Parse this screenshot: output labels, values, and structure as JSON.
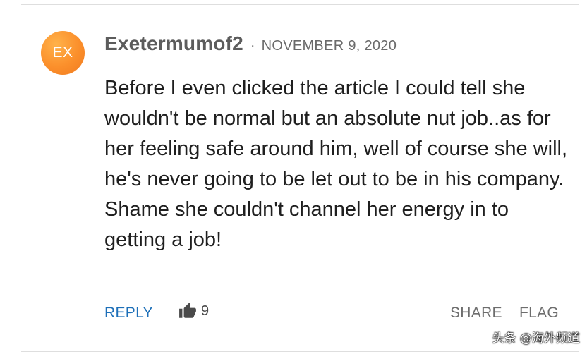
{
  "comment": {
    "avatar_initials": "EX",
    "username": "Exetermumof2",
    "separator": "·",
    "date": "NOVEMBER 9, 2020",
    "body": "Before I even clicked the article I could tell she wouldn't be normal but an absolute nut job..as for her feeling safe around him, well of course she will, he's never going to be let out to be in his company. Shame she couldn't channel her energy in to getting a job!"
  },
  "actions": {
    "reply_label": "REPLY",
    "like_icon": "thumbs-up-icon",
    "like_count": "9",
    "share_label": "SHARE",
    "flag_label": "FLAG"
  },
  "watermark": {
    "text": "头条 @海外频道"
  },
  "colors": {
    "avatar": "#fb8f2b",
    "reply": "#1d6fb8",
    "username": "#5c5c5c",
    "muted_action": "#6d6d6d"
  }
}
